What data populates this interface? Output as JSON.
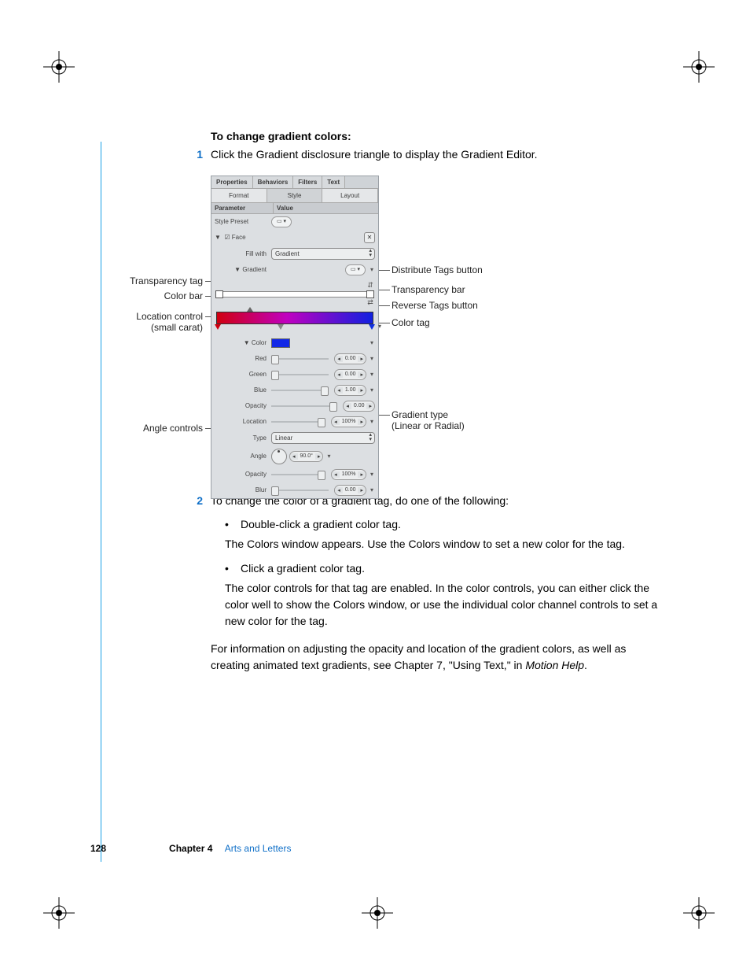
{
  "heading": "To change gradient colors:",
  "steps": {
    "s1_num": "1",
    "s1_text": "Click the Gradient disclosure triangle to display the Gradient Editor.",
    "s2_num": "2",
    "s2_text": "To change the color of a gradient tag, do one of the following:"
  },
  "bullets": {
    "b1": "Double-click a gradient color tag.",
    "b1_sub": "The Colors window appears. Use the Colors window to set a new color for the tag.",
    "b2": "Click a gradient color tag.",
    "b2_sub": "The color controls for that tag are enabled. In the color controls, you can either click the color well to show the Colors window, or use the individual color channel controls to set a new color for the tag."
  },
  "closing_a": "For information on adjusting the opacity and location of the gradient colors, as well as creating animated text gradients, see Chapter 7, \"Using Text,\" in ",
  "closing_b": "Motion Help",
  "closing_c": ".",
  "footer": {
    "page": "128",
    "chapter": "Chapter 4",
    "title": "Arts and Letters"
  },
  "panel": {
    "tabs": [
      "Properties",
      "Behaviors",
      "Filters",
      "Text"
    ],
    "subtabs": [
      "Format",
      "Style",
      "Layout"
    ],
    "hdr_param": "Parameter",
    "hdr_value": "Value",
    "style_preset": "Style Preset",
    "face": "Face",
    "fill_with": "Fill with",
    "fill_value": "Gradient",
    "gradient": "Gradient",
    "color": "Color",
    "red": "Red",
    "green": "Green",
    "blue": "Blue",
    "opacity": "Opacity",
    "location": "Location",
    "type": "Type",
    "type_value": "Linear",
    "angle": "Angle",
    "blur": "Blur",
    "values": {
      "red": "0.00",
      "green": "0.00",
      "blue": "1.00",
      "opacity": "0.00",
      "location": "100%",
      "angle": "90.0°",
      "g_opacity": "100%",
      "blur": "0.00"
    }
  },
  "callouts": {
    "transparency_tag": "Transparency tag",
    "color_bar": "Color bar",
    "location_control_a": "Location control",
    "location_control_b": "(small carat)",
    "angle_controls": "Angle controls",
    "distribute": "Distribute Tags button",
    "transparency_bar": "Transparency bar",
    "reverse": "Reverse Tags button",
    "color_tag": "Color tag",
    "gradient_type_a": "Gradient type",
    "gradient_type_b": "(Linear or Radial)"
  }
}
